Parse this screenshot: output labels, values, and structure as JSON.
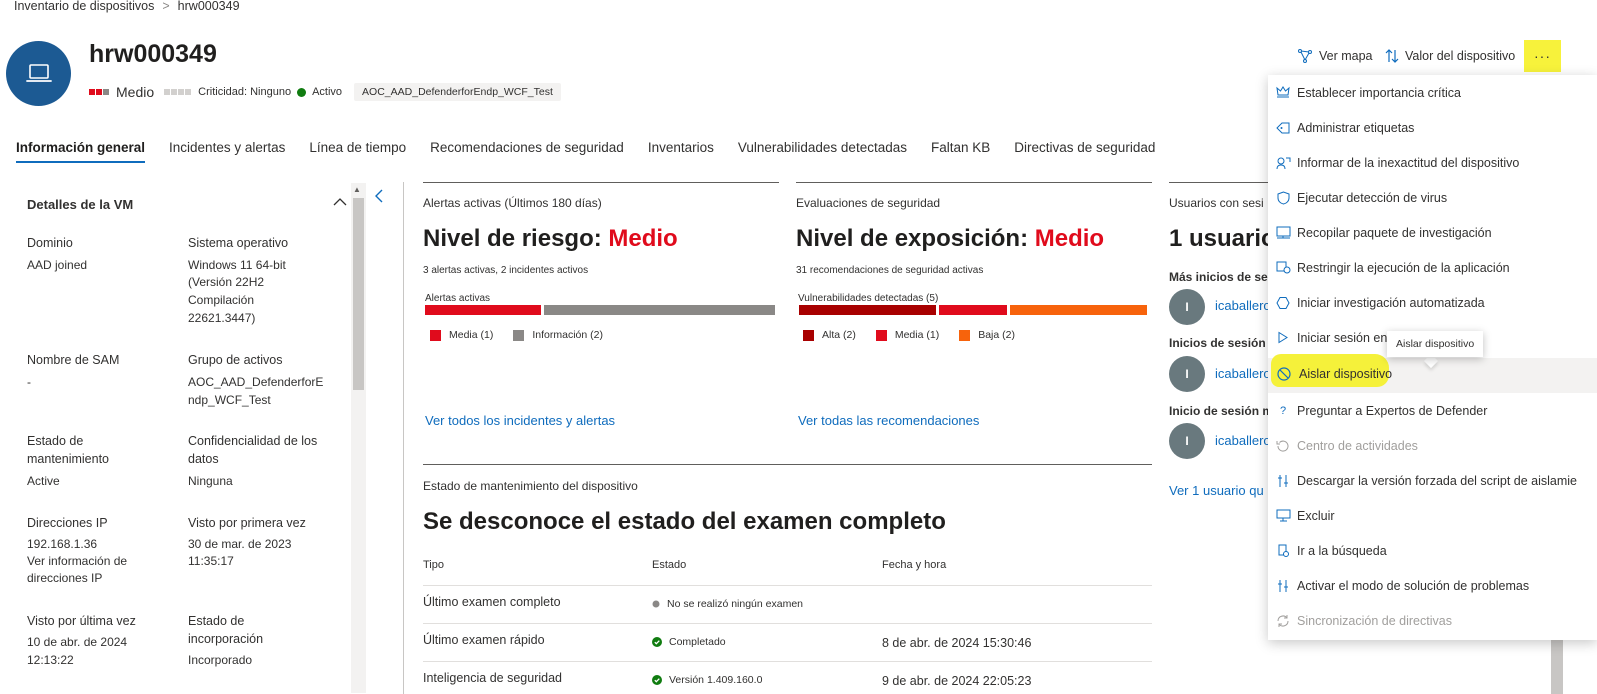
{
  "breadcrumb": {
    "root": "Inventario de dispositivos",
    "separator": ">",
    "current": "hrw000349"
  },
  "device": {
    "name": "hrw000349",
    "risk_label": "Medio",
    "criticality": "Criticidad: Ninguno",
    "status": "Activo",
    "tag": "AOC_AAD_DefenderforEndp_WCF_Test"
  },
  "top_actions": {
    "map": "Ver mapa",
    "value": "Valor del dispositivo",
    "more": "···"
  },
  "tabs": [
    "Información general",
    "Incidentes y alertas",
    "Línea de tiempo",
    "Recomendaciones de seguridad",
    "Inventarios",
    "Vulnerabilidades detectadas",
    "Faltan KB",
    "Directivas de seguridad"
  ],
  "vm": {
    "heading": "Detalles de la VM",
    "domain_label": "Dominio",
    "domain_value": "AAD joined",
    "os_label": "Sistema operativo",
    "os_value_1": "Windows 11 64-bit",
    "os_value_2": "(Versión 22H2",
    "os_value_3": "Compilación",
    "os_value_4": "22621.3447)",
    "sam_label": "Nombre de SAM",
    "sam_value": "-",
    "group_label": "Grupo de activos",
    "group_value_1": "AOC_AAD_DefenderforE",
    "group_value_2": "ndp_WCF_Test",
    "health_label_1": "Estado de",
    "health_label_2": "mantenimiento",
    "health_value": "Active",
    "conf_label_1": "Confidencialidad de los",
    "conf_label_2": "datos",
    "conf_value": "Ninguna",
    "ip_label": "Direcciones IP",
    "ip_value": "192.168.1.36",
    "ip_link_1": "Ver información de",
    "ip_link_2": "direcciones IP",
    "first_seen_label": "Visto por primera vez",
    "first_seen_1": "30 de mar. de 2023",
    "first_seen_2": "11:35:17",
    "last_seen_label": "Visto por última vez",
    "last_seen_1": "10 de abr. de 2024",
    "last_seen_2": "12:13:22",
    "onboard_label_1": "Estado de",
    "onboard_label_2": "incorporación",
    "onboard_value": "Incorporado"
  },
  "alerts_card": {
    "header": "Alertas activas (Últimos 180 días)",
    "title_prefix": "Nivel de riesgo: ",
    "title_value": "Medio",
    "summary": "3 alertas activas, 2 incidentes activos",
    "bar_label": "Alertas activas",
    "legend": [
      {
        "label": "Media (1)",
        "color": "#e00b1c"
      },
      {
        "label": "Información (2)",
        "color": "#8a8886"
      }
    ],
    "link": "Ver todos los incidentes y alertas"
  },
  "security_card": {
    "header": "Evaluaciones de seguridad",
    "title_prefix": "Nivel de exposición: ",
    "title_value": "Medio",
    "summary": "31 recomendaciones de seguridad activas",
    "bar_label": "Vulnerabilidades detectadas (5)",
    "legend": [
      {
        "label": "Alta (2)",
        "color": "#a80000"
      },
      {
        "label": "Media (1)",
        "color": "#e00b1c"
      },
      {
        "label": "Baja (2)",
        "color": "#f7630c"
      }
    ],
    "link": "Ver todas las recomendaciones"
  },
  "users_card": {
    "header": "Usuarios con sesi",
    "title": "1 usuario",
    "most_logons": "Más inicios de ses",
    "logons": "Inicios de sesión r",
    "last_logon": "Inicio de sesión m",
    "user": "icaballero",
    "initial": "I",
    "link": "Ver 1 usuario qu"
  },
  "health": {
    "header": "Estado de mantenimiento del dispositivo",
    "title": "Se desconoce el estado del examen completo",
    "col_type": "Tipo",
    "col_status": "Estado",
    "col_date": "Fecha y hora",
    "rows": [
      {
        "type": "Último examen completo",
        "status": "No se realizó ningún examen",
        "date": ""
      },
      {
        "type": "Último examen rápido",
        "status": "Completado",
        "date": "8 de abr. de 2024 15:30:46"
      },
      {
        "type": "Inteligencia de seguridad",
        "status": "Versión 1.409.160.0",
        "date": "9 de abr. de 2024 22:05:23"
      }
    ]
  },
  "menu": [
    "Establecer importancia crítica",
    "Administrar etiquetas",
    "Informar de la inexactitud del dispositivo",
    "Ejecutar detección de virus",
    "Recopilar paquete de investigación",
    "Restringir la ejecución de la aplicación",
    "Iniciar investigación automatizada",
    "Iniciar sesión en",
    "Aislar dispositivo",
    "Preguntar a Expertos de Defender",
    "Centro de actividades",
    "Descargar la versión forzada del script de aislamie",
    "Excluir",
    "Ir a la búsqueda",
    "Activar el modo de solución de problemas",
    "Sincronización de directivas"
  ],
  "tooltip": "Aislar dispositivo",
  "colors": {
    "accent": "#0f6cbd",
    "risk": "#e00b1c",
    "highlight": "#f7f23b",
    "avatar": "#1c5a93"
  }
}
